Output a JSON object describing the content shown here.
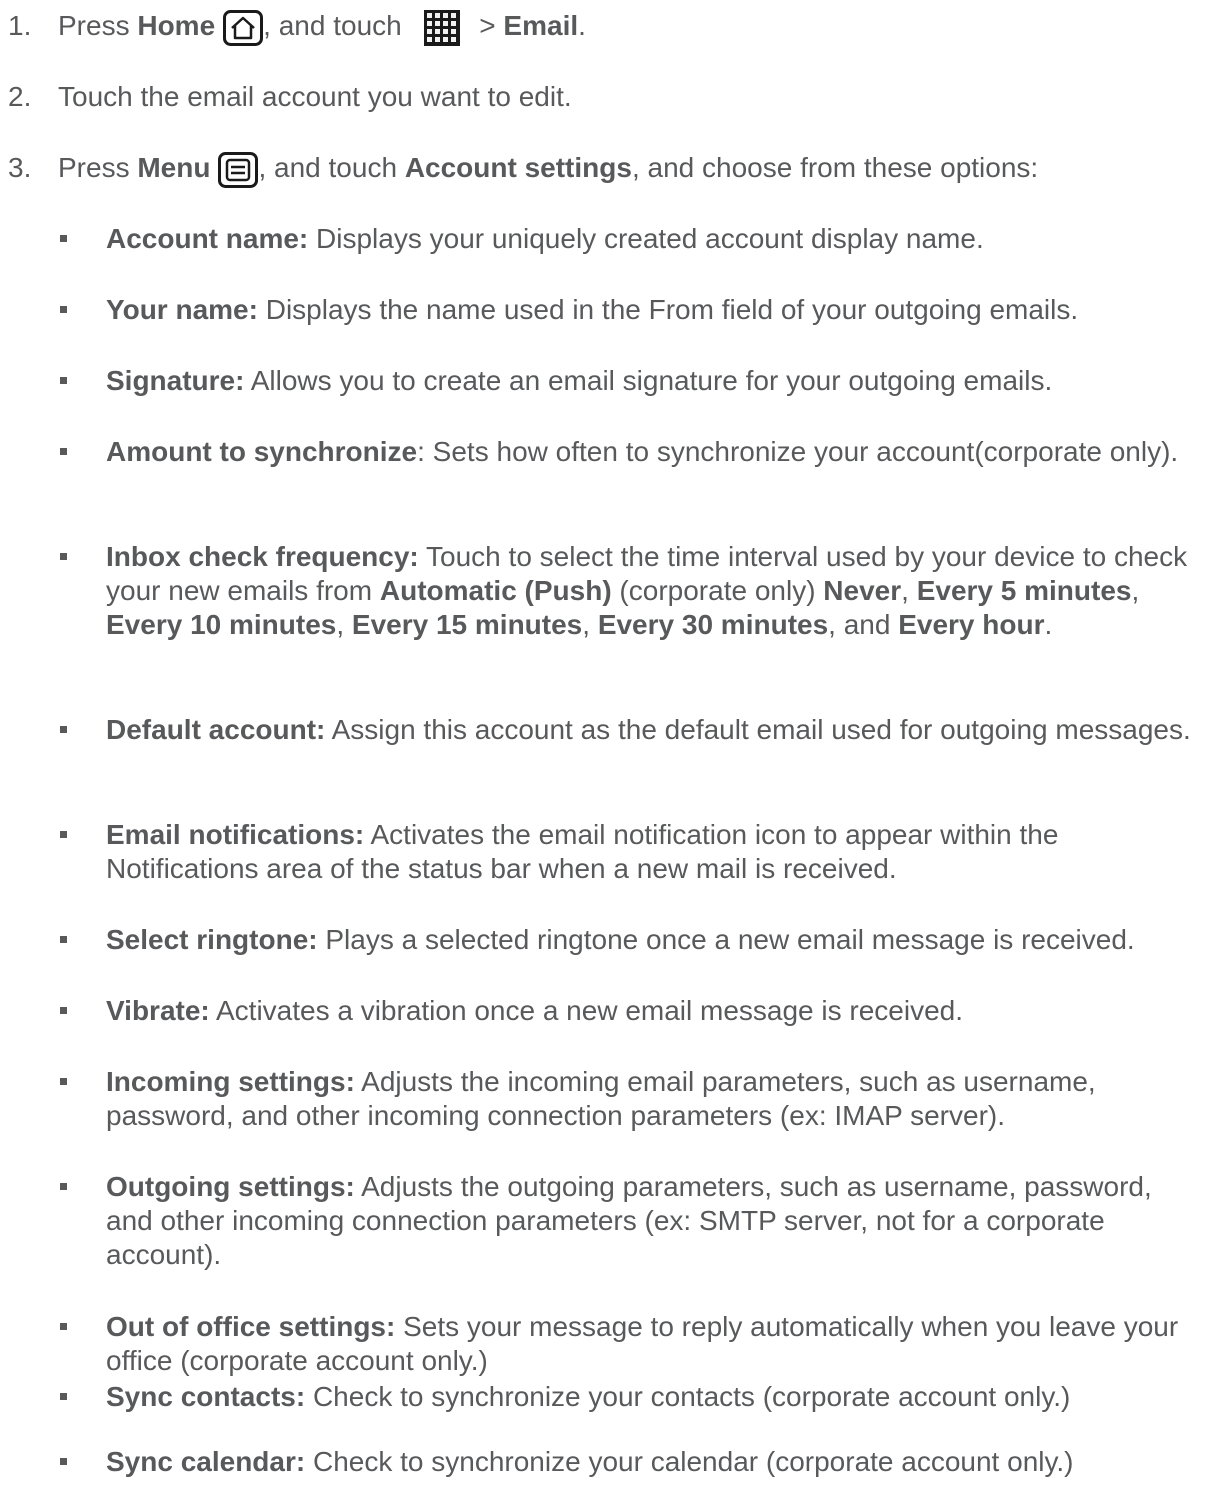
{
  "steps": [
    {
      "number": "1.",
      "t1": "Press ",
      "b1": "Home",
      "t2": ", and touch ",
      "t3": " > ",
      "b2": "Email",
      "t4": "."
    },
    {
      "number": "2.",
      "t1": "Touch the email account you want to edit."
    },
    {
      "number": "3.",
      "t1": "Press ",
      "b1": "Menu",
      "t2": ", and touch ",
      "b2": "Account settings",
      "t3": ", and choose from these options:"
    }
  ],
  "icons": {
    "home": "home-icon",
    "apps": "apps-grid-icon",
    "menu": "menu-icon"
  },
  "options": [
    {
      "term": "Account name:",
      "text": " Displays your uniquely created account display name."
    },
    {
      "term": "Your name:",
      "text": " Displays the name used in the From field of your outgoing emails."
    },
    {
      "term": "Signature:",
      "text": " Allows you to create an email signature for your outgoing emails."
    },
    {
      "term": "Amount to synchronize",
      "text": ": Sets how often to synchronize your account(corporate only)."
    },
    {
      "term": "Inbox check frequency:",
      "text": " Touch to select the time interval used by your device to check your new emails from ",
      "b1": "Automatic (Push)",
      "t1": " (corporate only) ",
      "b2": "Never",
      "t2": ", ",
      "b3": "Every 5 minutes",
      "t3": ", ",
      "b4": "Every 10 minutes",
      "t4": ", ",
      "b5": "Every 15 minutes",
      "t5": ", ",
      "b6": "Every 30 minutes",
      "t6": ", and ",
      "b7": "Every hour",
      "t7": "."
    },
    {
      "term": "Default account:",
      "text": " Assign this account as the default email used for outgoing messages."
    },
    {
      "term": "Email notifications:",
      "text": " Activates the email notification icon to appear within the Notifications area of the status bar when a new mail is received."
    },
    {
      "term": "Select ringtone:",
      "text": " Plays a selected ringtone once a new email message is received."
    },
    {
      "term": "Vibrate:",
      "text": " Activates a vibration once a new email message is received."
    },
    {
      "term": "Incoming settings:",
      "text": " Adjusts the incoming email parameters, such as username, password, and other incoming connection parameters (ex: IMAP server)."
    },
    {
      "term": "Outgoing settings:",
      "text": " Adjusts the outgoing parameters, such as username, password, and other incoming connection parameters (ex: SMTP server, not for a corporate account)."
    },
    {
      "term": "Out of office settings:",
      "text": " Sets your message to reply automatically when you leave your office (corporate account only.)"
    },
    {
      "term": "Sync contacts:",
      "text": " Check to synchronize your contacts (corporate account only.)"
    },
    {
      "term": "Sync calendar:",
      "text": " Check to synchronize your calendar (corporate account only.)"
    }
  ]
}
